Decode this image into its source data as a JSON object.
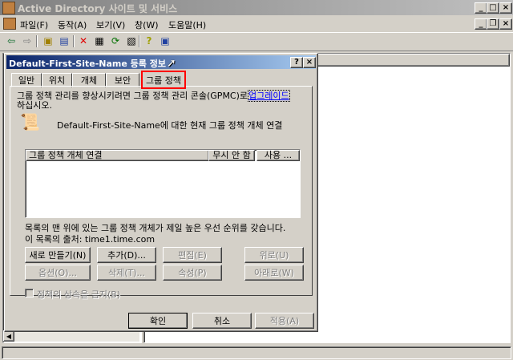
{
  "app": {
    "title": "Active Directory 사이트 및 서비스",
    "menu": [
      "파일(F)",
      "동작(A)",
      "보기(V)",
      "창(W)",
      "도움말(H)"
    ]
  },
  "dialog": {
    "title": "Default-First-Site-Name 등록 정보",
    "help_btn": "?",
    "close_btn": "×",
    "tabs": [
      "일반",
      "위치",
      "개체",
      "보안",
      "그룹 정책"
    ],
    "info_text": "그룹 정책 관리를 향상시키려면 그룹 정책 관리 콘솔(GPMC)로",
    "info_link": "업그레이드",
    "info_text2": "하십시오.",
    "gpo_heading": "Default-First-Site-Name에 대한 현재 그룹 정책 개체 연결",
    "list_headers": [
      "그룹 정책 개체 연결",
      "무시 안 함",
      "사용 ..."
    ],
    "priority_note": "목록의 맨 위에 있는 그룹 정책 개체가 제일 높은 우선 순위를 갖습니다.",
    "source_note": "이 목록의 출처: time1.time.com",
    "buttons": {
      "new": "새로 만들기(N)",
      "add": "추가(D)...",
      "edit": "편집(E)",
      "up": "위로(U)",
      "options": "옵션(O)...",
      "delete": "삭제(T)...",
      "properties": "속성(P)",
      "down": "아래로(W)"
    },
    "block_inheritance": "정책의 상속을 금지(B)",
    "ok": "확인",
    "cancel": "취소",
    "apply": "적용(A)"
  },
  "colors": {
    "title_active": "#0a246a",
    "title_active_end": "#a6caf0",
    "title_inactive": "#808080",
    "title_inactive_end": "#c0c0c0",
    "highlight_box": "#ff0000"
  }
}
